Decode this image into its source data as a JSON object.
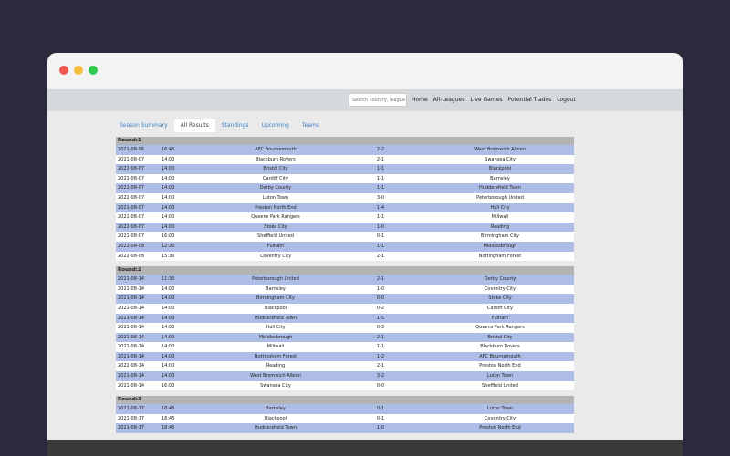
{
  "search": {
    "placeholder": "Search country, league..."
  },
  "nav": [
    "Home",
    "All-Leagues",
    "Live Games",
    "Potential Trades",
    "Logout"
  ],
  "tabs": [
    "Season Summary",
    "All Results",
    "Standings",
    "Upcoming",
    "Teams"
  ],
  "rounds": [
    {
      "label": "Round:1",
      "matches": [
        [
          "2021-08-06",
          "16:45",
          "AFC Bournemouth",
          "2-2",
          "West Bromwich Albion"
        ],
        [
          "2021-08-07",
          "14:00",
          "Blackburn Rovers",
          "2-1",
          "Swansea City"
        ],
        [
          "2021-08-07",
          "14:00",
          "Bristol City",
          "1-1",
          "Blackpool"
        ],
        [
          "2021-08-07",
          "14:00",
          "Cardiff City",
          "1-1",
          "Barnsley"
        ],
        [
          "2021-08-07",
          "14:00",
          "Derby County",
          "1-1",
          "Huddersfield Town"
        ],
        [
          "2021-08-07",
          "14:00",
          "Luton Town",
          "3-0",
          "Peterborough United"
        ],
        [
          "2021-08-07",
          "14:00",
          "Preston North End",
          "1-4",
          "Hull City"
        ],
        [
          "2021-08-07",
          "14:00",
          "Queens Park Rangers",
          "1-1",
          "Millwall"
        ],
        [
          "2021-08-07",
          "14:00",
          "Stoke City",
          "1-0",
          "Reading"
        ],
        [
          "2021-08-07",
          "16:00",
          "Sheffield United",
          "0-1",
          "Birmingham City"
        ],
        [
          "2021-08-08",
          "12:30",
          "Fulham",
          "1-1",
          "Middlesbrough"
        ],
        [
          "2021-08-08",
          "15:30",
          "Coventry City",
          "2-1",
          "Nottingham Forest"
        ]
      ]
    },
    {
      "label": "Round:2",
      "matches": [
        [
          "2021-08-14",
          "11:30",
          "Peterborough United",
          "2-1",
          "Derby County"
        ],
        [
          "2021-08-14",
          "14:00",
          "Barnsley",
          "1-0",
          "Coventry City"
        ],
        [
          "2021-08-14",
          "14:00",
          "Birmingham City",
          "0-0",
          "Stoke City"
        ],
        [
          "2021-08-14",
          "14:00",
          "Blackpool",
          "0-2",
          "Cardiff City"
        ],
        [
          "2021-08-14",
          "14:00",
          "Huddersfield Town",
          "1-5",
          "Fulham"
        ],
        [
          "2021-08-14",
          "14:00",
          "Hull City",
          "0-3",
          "Queens Park Rangers"
        ],
        [
          "2021-08-14",
          "14:00",
          "Middlesbrough",
          "2-1",
          "Bristol City"
        ],
        [
          "2021-08-14",
          "14:00",
          "Millwall",
          "1-1",
          "Blackburn Rovers"
        ],
        [
          "2021-08-14",
          "14:00",
          "Nottingham Forest",
          "1-2",
          "AFC Bournemouth"
        ],
        [
          "2021-08-14",
          "14:00",
          "Reading",
          "2-1",
          "Preston North End"
        ],
        [
          "2021-08-14",
          "14:00",
          "West Bromwich Albion",
          "3-2",
          "Luton Town"
        ],
        [
          "2021-08-14",
          "16:00",
          "Swansea City",
          "0-0",
          "Sheffield United"
        ]
      ]
    },
    {
      "label": "Round:3",
      "matches": [
        [
          "2021-08-17",
          "18:45",
          "Barnsley",
          "0-1",
          "Luton Town"
        ],
        [
          "2021-08-17",
          "18:45",
          "Blackpool",
          "0-1",
          "Coventry City"
        ],
        [
          "2021-08-17",
          "18:45",
          "Huddersfield Town",
          "1-0",
          "Preston North End"
        ]
      ]
    }
  ]
}
